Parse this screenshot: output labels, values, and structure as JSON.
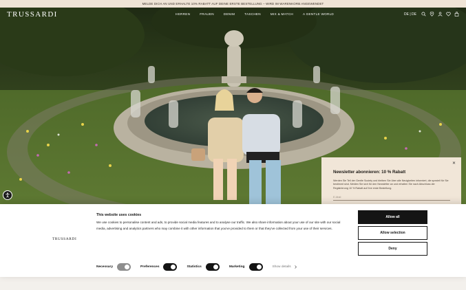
{
  "promo_bar": {
    "text": "MELDE DICH AN UND ERHALTE 10% RABATT AUF DEINE ERSTE BESTELLUNG – WIRD IM WARENKORB ANGEWENDET"
  },
  "header": {
    "logo": "TRUSSARDI",
    "nav": [
      "HERREN",
      "FRAUEN",
      "DENIM",
      "TASCHEN",
      "MIX & MATCH",
      "A GENTLE WORLD"
    ],
    "lang": "DE | DE",
    "icons": [
      "search-icon",
      "location-icon",
      "user-icon",
      "wishlist-icon",
      "cart-icon"
    ]
  },
  "newsletter": {
    "close": "✕",
    "title": "Newsletter abonnieren: 10 % Rabatt",
    "text": "Werden Sie Teil der Gentle Society und bleiben Sie über alle Neuigkeiten informiert, die speziell für Sie bestimmt sind. Melden Sie sich für den Newsletter an und erhalten Sie nach Abschluss der Registrierung 10 % Rabatt auf Ihre erste Bestellung.",
    "email_placeholder": "E-Mail"
  },
  "cookie": {
    "logo": "TRUSSARDI",
    "title": "This website uses cookies",
    "text": "We use cookies to personalise content and ads, to provide social media features and to analyse our traffic. We also share information about your use of our site with our social media, advertising and analytics partners who may combine it with other information that you've provided to them or that they've collected from your use of their services.",
    "toggles": [
      {
        "label": "Necessary",
        "state": "on-disabled"
      },
      {
        "label": "Preferences",
        "state": "on"
      },
      {
        "label": "Statistics",
        "state": "on"
      },
      {
        "label": "Marketing",
        "state": "on"
      }
    ],
    "show_details": "Show details",
    "buttons": {
      "allow_all": "Allow all",
      "allow_selection": "Allow selection",
      "deny": "Deny"
    }
  },
  "accessibility": {
    "icon": "accessibility-icon"
  },
  "colors": {
    "promo_bg": "#efe4d6",
    "newsletter_bg": "#f1e6d8",
    "button_dark": "#141414"
  }
}
